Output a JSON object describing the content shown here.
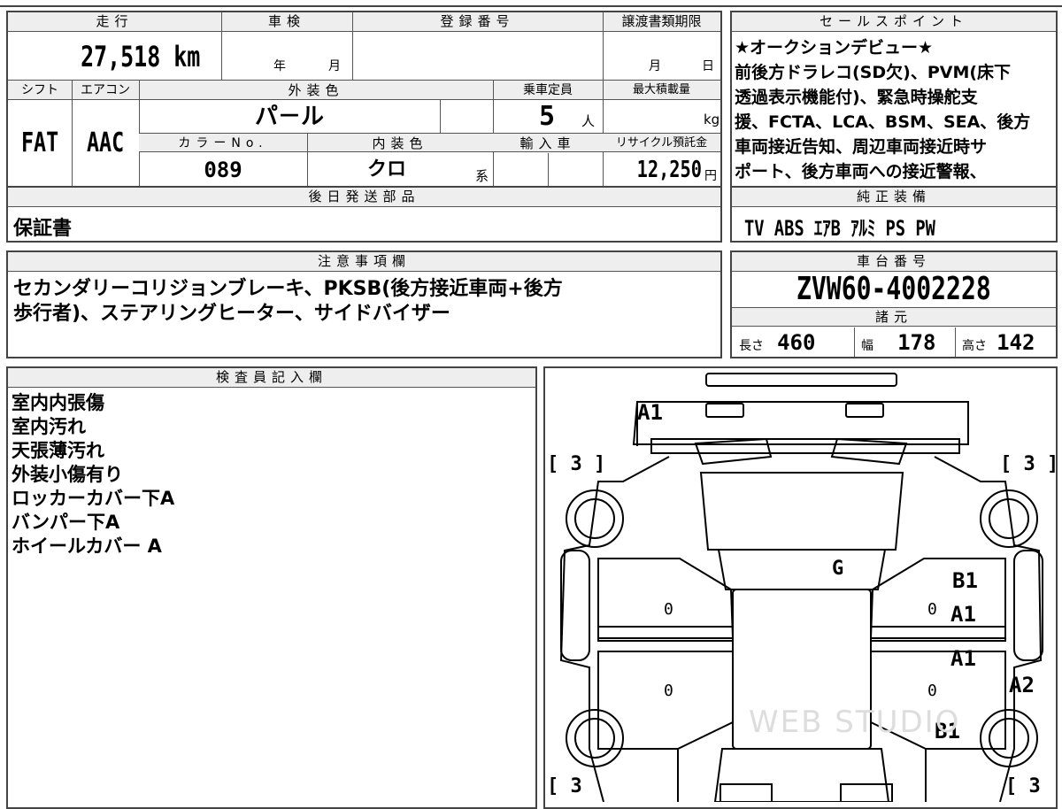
{
  "vehicle": {
    "mileage_label": "走行",
    "mileage_value": "27,518",
    "mileage_unit": "km",
    "inspection_label": "車検",
    "inspection_year_unit": "年",
    "inspection_month_unit": "月",
    "registration_label": "登録番号",
    "transfer_deadline_label": "譲渡書類期限",
    "transfer_month_unit": "月",
    "transfer_day_unit": "日",
    "shift_label": "シフト",
    "shift_value": "FAT",
    "aircon_label": "エアコン",
    "aircon_value": "AAC",
    "exterior_color_label": "外装色",
    "exterior_color_value": "パ－ル",
    "capacity_label": "乗車定員",
    "capacity_value": "5",
    "capacity_unit": "人",
    "max_load_label": "最大積載量",
    "max_load_unit": "kg",
    "color_no_label": "カラーNo.",
    "color_no_value": "089",
    "interior_color_label": "内装色",
    "interior_color_value": "クロ",
    "interior_color_suffix": "系",
    "import_label": "輸入車",
    "recycle_label": "リサイクル預託金",
    "recycle_value": "12,250",
    "recycle_unit": "円",
    "later_parts_label": "後日発送部品",
    "later_parts_value": "保証書"
  },
  "sales_points": {
    "label": "セールスポイント",
    "lines": [
      "★オークションデビュー★",
      "前後方ドラレコ(SD欠)、PVM(床下",
      "透過表示機能付)、緊急時操舵支",
      "援、FCTA、LCA、BSM、SEA、後方",
      "車両接近告知、周辺車両接近時サ",
      "ポート、後方車両への接近警報、"
    ]
  },
  "genuine_equipment": {
    "label": "純正装備",
    "value": "TV  ABS  ｴｱB  ｱﾙﾐ  PS  PW"
  },
  "notes": {
    "label": "注意事項欄",
    "lines": [
      "セカンダリーコリジョンブレーキ、PKSB(後方接近車両+後方",
      "歩行者)、ステアリングヒーター、サイドバイザー"
    ]
  },
  "chassis": {
    "label": "車台番号",
    "value": "ZVW60-4002228",
    "specs_label": "諸元",
    "length_label": "長さ",
    "length_value": "460",
    "width_label": "幅",
    "width_value": "178",
    "height_label": "高さ",
    "height_value": "142"
  },
  "inspector": {
    "label": "検査員記入欄",
    "lines": [
      "室内内張傷",
      "室内汚れ",
      "天張薄汚れ",
      "外装小傷有り",
      "ロッカーカバー下A",
      "バンパー下A",
      "ホイールカバー A"
    ]
  },
  "diagram": {
    "marks": {
      "front_bumper": "A1",
      "windshield": "G",
      "right_front_door": "B1",
      "right_front_door_2": "A1",
      "right_rear_door": "A1",
      "right_rear_quarter": "A2",
      "right_rear_lower": "B1"
    },
    "tire_left_front": "[ 3 ]",
    "tire_right_front": "[ 3 ]",
    "tire_left_rear": "[ 3",
    "tire_right_rear": "[ 3",
    "zero_marks": [
      "0",
      "0",
      "0",
      "0"
    ],
    "watermark": "WEB STUDIO"
  }
}
